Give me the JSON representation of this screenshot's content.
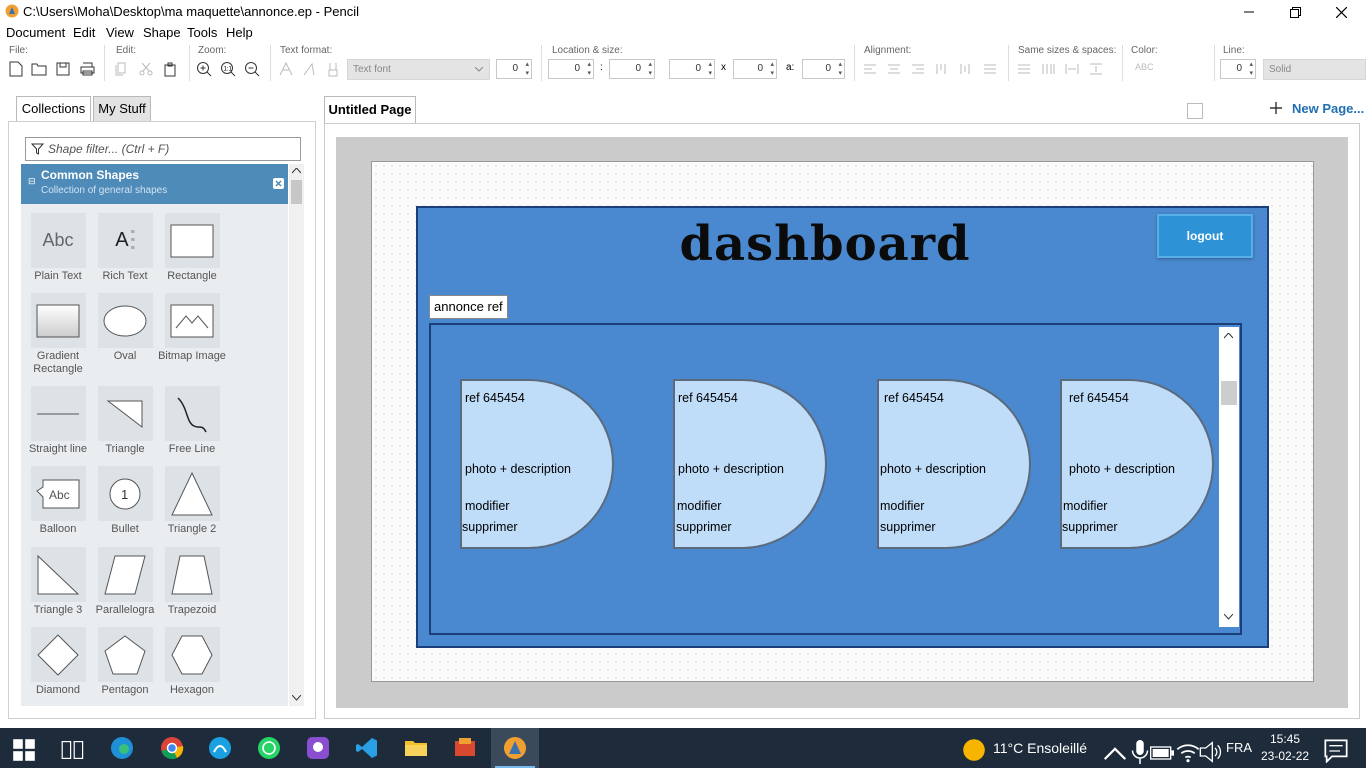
{
  "window": {
    "title": "C:\\Users\\Moha\\Desktop\\ma maquette\\annonce.ep - Pencil"
  },
  "menu": [
    "Document",
    "Edit",
    "View",
    "Shape",
    "Tools",
    "Help"
  ],
  "toolbar": {
    "groups": {
      "file": "File:",
      "edit": "Edit:",
      "zoom": "Zoom:",
      "text_format": "Text format:",
      "location_size": "Location & size:",
      "alignment": "Alignment:",
      "same_sizes": "Same sizes & spaces:",
      "color": "Color:",
      "line": "Line:"
    },
    "font_placeholder": "Text font",
    "font_size": "0",
    "loc_x": "0",
    "loc_y": "0",
    "width": "0",
    "height": "0",
    "angle": "0",
    "x_sep": ":",
    "size_sep": "x",
    "angle_label": "a:",
    "color_text": "ABC",
    "line_width": "0",
    "line_style": "Solid"
  },
  "left_panel": {
    "tabs": [
      "Collections",
      "My Stuff"
    ],
    "filter_placeholder": "Shape filter... (Ctrl + F)",
    "collection": {
      "title": "Common Shapes",
      "subtitle": "Collection of general shapes"
    },
    "shapes": [
      {
        "label": "Plain Text",
        "icon": "plain-text-icon",
        "thumb": "Abc"
      },
      {
        "label": "Rich Text",
        "icon": "rich-text-icon",
        "thumb": "A"
      },
      {
        "label": "Rectangle",
        "icon": "rectangle-icon"
      },
      {
        "label": "Gradient Rectangle",
        "icon": "gradient-rectangle-icon"
      },
      {
        "label": "Oval",
        "icon": "oval-icon"
      },
      {
        "label": "Bitmap Image",
        "icon": "bitmap-image-icon"
      },
      {
        "label": "Straight line",
        "icon": "straight-line-icon"
      },
      {
        "label": "Triangle",
        "icon": "triangle-icon"
      },
      {
        "label": "Free Line",
        "icon": "free-line-icon"
      },
      {
        "label": "Balloon",
        "icon": "balloon-icon",
        "thumb": "Abc"
      },
      {
        "label": "Bullet",
        "icon": "bullet-icon",
        "thumb": "1"
      },
      {
        "label": "Triangle 2",
        "icon": "triangle-2-icon"
      },
      {
        "label": "Triangle 3",
        "icon": "triangle-3-icon"
      },
      {
        "label": "Parallelogra",
        "icon": "parallelogram-icon"
      },
      {
        "label": "Trapezoid",
        "icon": "trapezoid-icon"
      },
      {
        "label": "Diamond",
        "icon": "diamond-icon"
      },
      {
        "label": "Pentagon",
        "icon": "pentagon-icon"
      },
      {
        "label": "Hexagon",
        "icon": "hexagon-icon"
      }
    ]
  },
  "page": {
    "tab_label": "Untitled Page",
    "new_page_label": "New Page..."
  },
  "mockup": {
    "title": "dashboard",
    "logout_label": "logout",
    "annonce_ref_label": "annonce ref",
    "cards": [
      {
        "ref": "ref 645454",
        "description": "photo + description",
        "modify": "modifier",
        "delete": "supprimer"
      },
      {
        "ref": "ref 645454",
        "description": "photo + description",
        "modify": "modifier",
        "delete": "supprimer"
      },
      {
        "ref": "ref 645454",
        "description": "photo + description",
        "modify": "modifier",
        "delete": "supprimer"
      },
      {
        "ref": "ref 645454",
        "description": "photo + description",
        "modify": "modifier",
        "delete": "supprimer"
      }
    ],
    "colors": {
      "panel": "#4a89cf",
      "card": "#bfdcf8",
      "logout": "#2e93d6"
    }
  },
  "taskbar": {
    "weather": "11°C  Ensoleillé",
    "language": "FRA",
    "time": "15:45",
    "date": "23-02-22"
  }
}
